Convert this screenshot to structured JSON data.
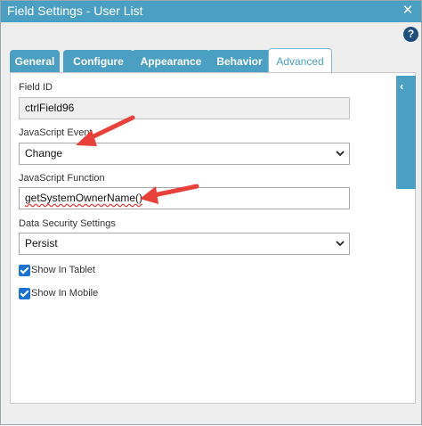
{
  "window": {
    "title": "Field Settings - User List",
    "close_glyph": "✕",
    "help_glyph": "?"
  },
  "tabs": [
    {
      "label": "General",
      "active": false
    },
    {
      "label": "Configure",
      "active": false
    },
    {
      "label": "Appearance",
      "active": false
    },
    {
      "label": "Behavior",
      "active": false
    },
    {
      "label": "Advanced",
      "active": true
    }
  ],
  "collapse_glyph": "‹",
  "form": {
    "field_id": {
      "label": "Field ID",
      "value": "ctrlField96"
    },
    "js_event": {
      "label": "JavaScript Event",
      "value": "Change"
    },
    "js_function": {
      "label": "JavaScript Function",
      "value": "getSystemOwnerName()"
    },
    "data_security": {
      "label": "Data Security Settings",
      "value": "Persist"
    },
    "show_in_tablet": {
      "label": "Show In Tablet",
      "checked": true
    },
    "show_in_mobile": {
      "label": "Show In Mobile",
      "checked": true
    }
  },
  "icons": {
    "close": "close-icon",
    "help": "help-icon",
    "collapse": "chevron-left-icon",
    "dropdown": "chevron-down-icon"
  },
  "colors": {
    "accent": "#4a9fc2",
    "help": "#1e4f7c",
    "checkbox": "#1b72d0",
    "annotation_arrow": "#e8403a"
  }
}
